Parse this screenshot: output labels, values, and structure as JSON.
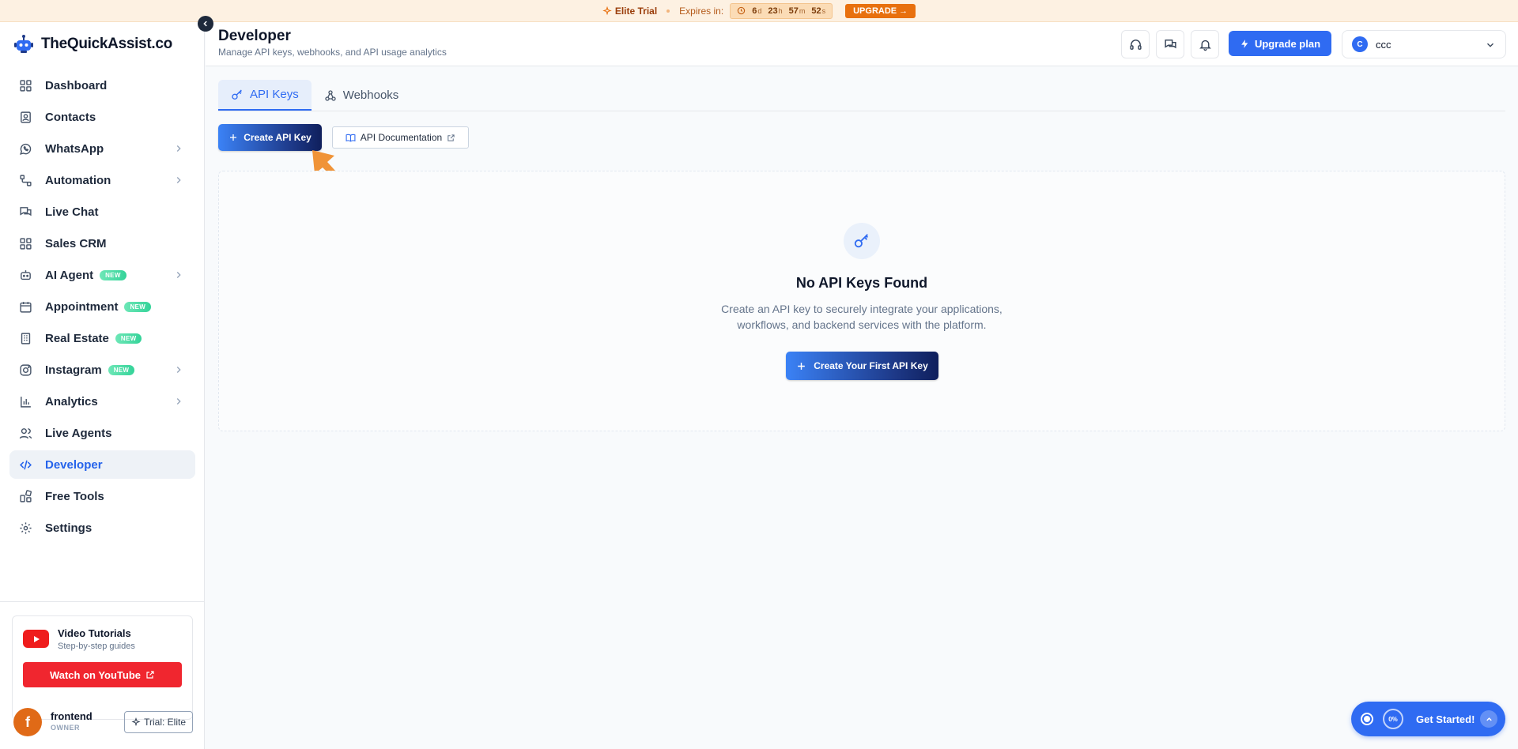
{
  "banner": {
    "plan": "Elite Trial",
    "expires_label": "Expires in:",
    "countdown": [
      {
        "value": "6",
        "unit": "d"
      },
      {
        "value": "23",
        "unit": "h"
      },
      {
        "value": "57",
        "unit": "m"
      },
      {
        "value": "52",
        "unit": "s"
      }
    ],
    "upgrade": "UPGRADE →"
  },
  "brand": {
    "name": "TheQuickAssist.co"
  },
  "sidebar": {
    "items": [
      {
        "label": "Dashboard"
      },
      {
        "label": "Contacts"
      },
      {
        "label": "WhatsApp"
      },
      {
        "label": "Automation"
      },
      {
        "label": "Live Chat"
      },
      {
        "label": "Sales CRM"
      },
      {
        "label": "AI Agent",
        "badge": "NEW"
      },
      {
        "label": "Appointment",
        "badge": "NEW"
      },
      {
        "label": "Real Estate",
        "badge": "NEW"
      },
      {
        "label": "Instagram",
        "badge": "NEW"
      },
      {
        "label": "Analytics"
      },
      {
        "label": "Live Agents"
      },
      {
        "label": "Developer"
      },
      {
        "label": "Free Tools"
      },
      {
        "label": "Settings"
      }
    ],
    "tutorial": {
      "title": "Video Tutorials",
      "subtitle": "Step-by-step guides",
      "button": "Watch on YouTube"
    },
    "user": {
      "initial": "f",
      "name": "frontend",
      "role": "OWNER",
      "trial": "Trial: Elite"
    }
  },
  "header": {
    "title": "Developer",
    "subtitle": "Manage API keys, webhooks, and API usage analytics",
    "upgrade_label": "Upgrade plan",
    "account": {
      "initial": "C",
      "name": "ccc"
    }
  },
  "tabs": [
    {
      "label": "API Keys"
    },
    {
      "label": "Webhooks"
    }
  ],
  "actions": {
    "create": "Create API Key",
    "docs": "API Documentation"
  },
  "empty_state": {
    "title": "No API Keys Found",
    "description": "Create an API key to securely integrate your applications, workflows, and backend services with the platform.",
    "button": "Create Your First API Key"
  },
  "get_started": {
    "percent": "0%",
    "label": "Get Started!"
  },
  "colors": {
    "accent": "#2f6bf2",
    "banner_bg": "#fdf1e2",
    "upgrade_orange": "#e8700e",
    "youtube_red": "#f0262f"
  }
}
